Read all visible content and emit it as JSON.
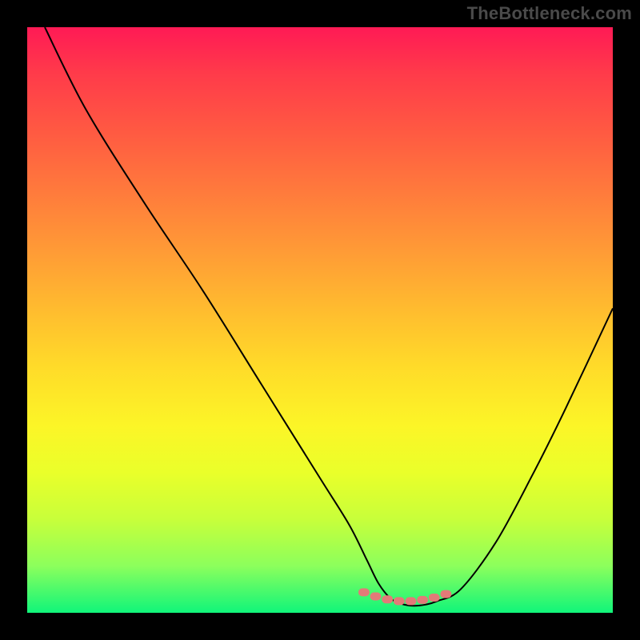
{
  "watermark": "TheBottleneck.com",
  "colors": {
    "page_bg": "#000000",
    "curve_stroke": "#000000",
    "marker_fill": "#e27a78",
    "gradient_top": "#ff1a55",
    "gradient_bottom": "#10f57a"
  },
  "chart_data": {
    "type": "line",
    "title": "",
    "xlabel": "",
    "ylabel": "",
    "xlim": [
      0,
      100
    ],
    "ylim": [
      0,
      100
    ],
    "grid": false,
    "series": [
      {
        "name": "bottleneck-curve",
        "x": [
          3,
          10,
          20,
          30,
          40,
          50,
          55,
          58,
          60,
          62,
          64,
          66,
          68,
          70,
          74,
          80,
          86,
          92,
          100
        ],
        "y": [
          100,
          86,
          70,
          55,
          39,
          23,
          15,
          9,
          5,
          2.5,
          1.5,
          1.2,
          1.4,
          2,
          4,
          12,
          23,
          35,
          52
        ]
      }
    ],
    "markers": {
      "name": "highlight-band",
      "x": [
        57.5,
        59.5,
        61.5,
        63.5,
        65.5,
        67.5,
        69.5,
        71.5
      ],
      "y": [
        3.5,
        2.8,
        2.3,
        2.0,
        2.0,
        2.2,
        2.6,
        3.2
      ]
    }
  }
}
